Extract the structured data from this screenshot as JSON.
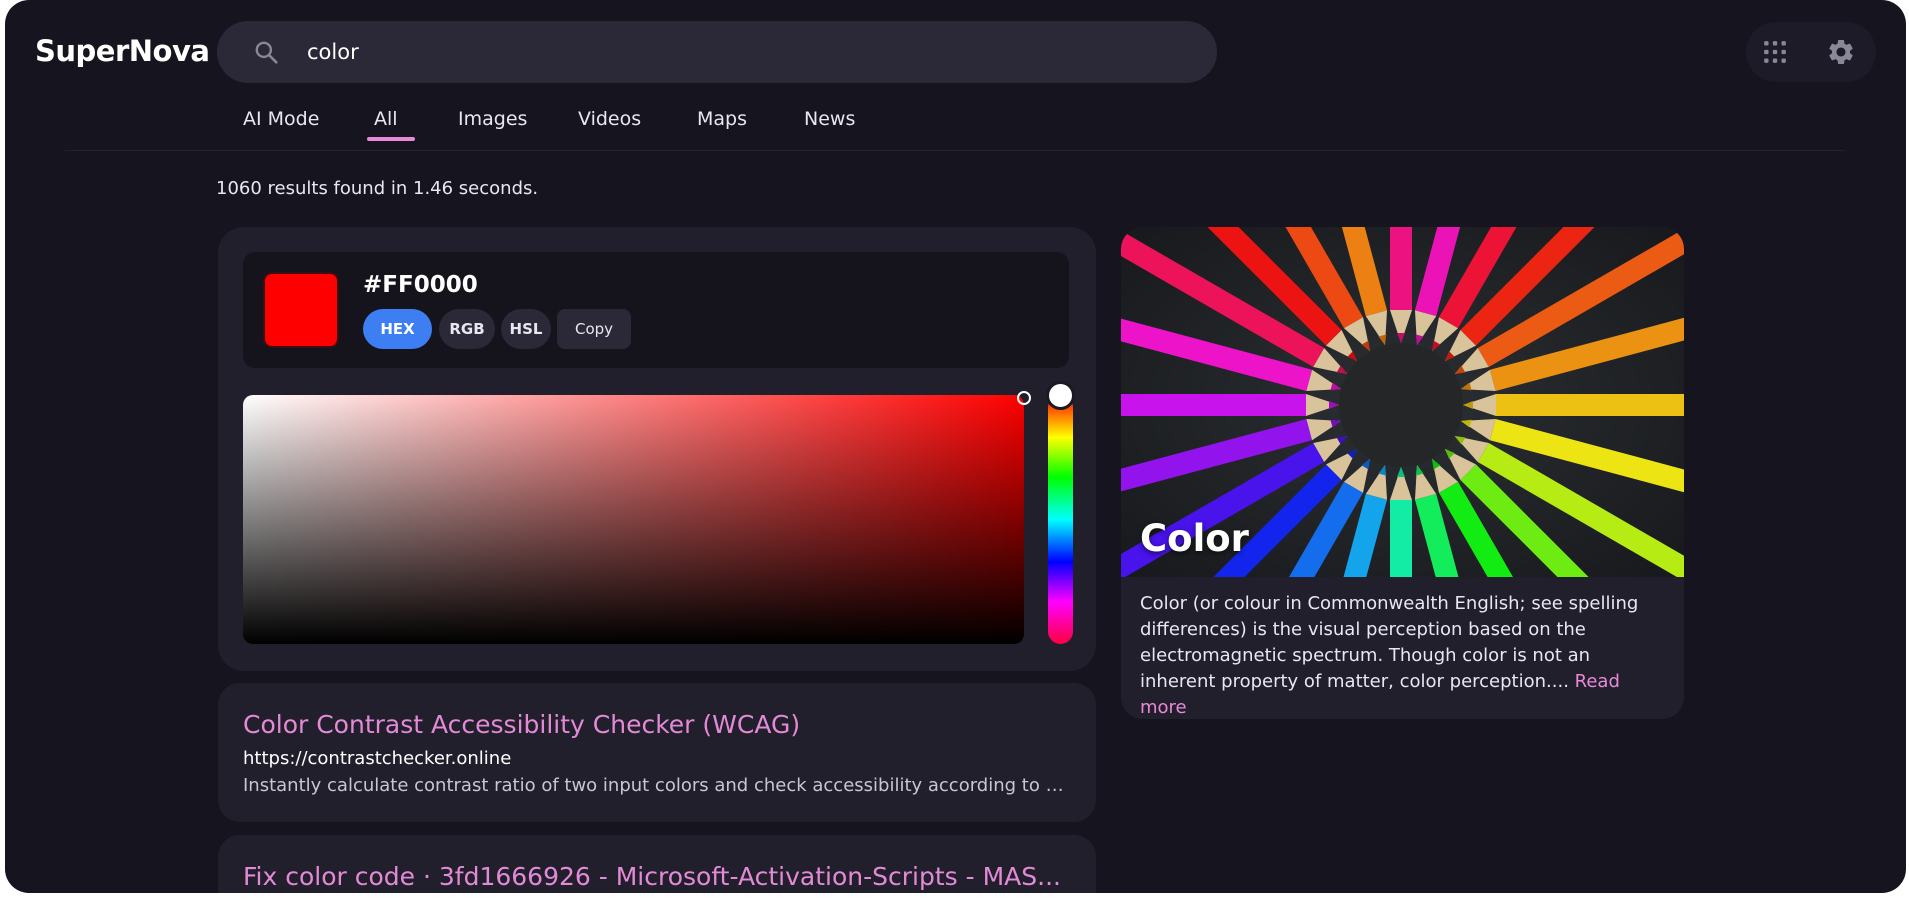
{
  "app": {
    "name": "SuperNova"
  },
  "search": {
    "query": "color"
  },
  "tabs": [
    {
      "label": "AI Mode"
    },
    {
      "label": "All",
      "active": true
    },
    {
      "label": "Images"
    },
    {
      "label": "Videos"
    },
    {
      "label": "Maps"
    },
    {
      "label": "News"
    }
  ],
  "results_summary": "1060 results found in 1.46 seconds.",
  "color_picker": {
    "value": "#FF0000",
    "swatch_color": "#FF0000",
    "formats": [
      "HEX",
      "RGB",
      "HSL"
    ],
    "active_format": "HEX",
    "copy_label": "Copy"
  },
  "results": [
    {
      "title": "Color Contrast Accessibility Checker (WCAG)",
      "url": "https://contrastchecker.online",
      "snippet": "Instantly calculate contrast ratio of two input colors and check accessibility according to Web ..."
    },
    {
      "title": "Fix color code · 3fd1666926 - Microsoft-Activation-Scripts - MAS..."
    }
  ],
  "knowledge_panel": {
    "title": "Color",
    "description": "Color (or colour in Commonwealth English; see spelling differences) is the visual perception based on the electromagnetic spectrum. Though color is not an inherent property of matter, color perception....",
    "read_more": "Read more"
  },
  "icons": {
    "search": "search-icon",
    "apps": "apps-grid-icon",
    "settings": "gear-icon"
  },
  "colors": {
    "background": "#16151f",
    "card": "#221f2d",
    "accent_pink": "#e38ad6",
    "accent_blue": "#3d7ef2"
  }
}
